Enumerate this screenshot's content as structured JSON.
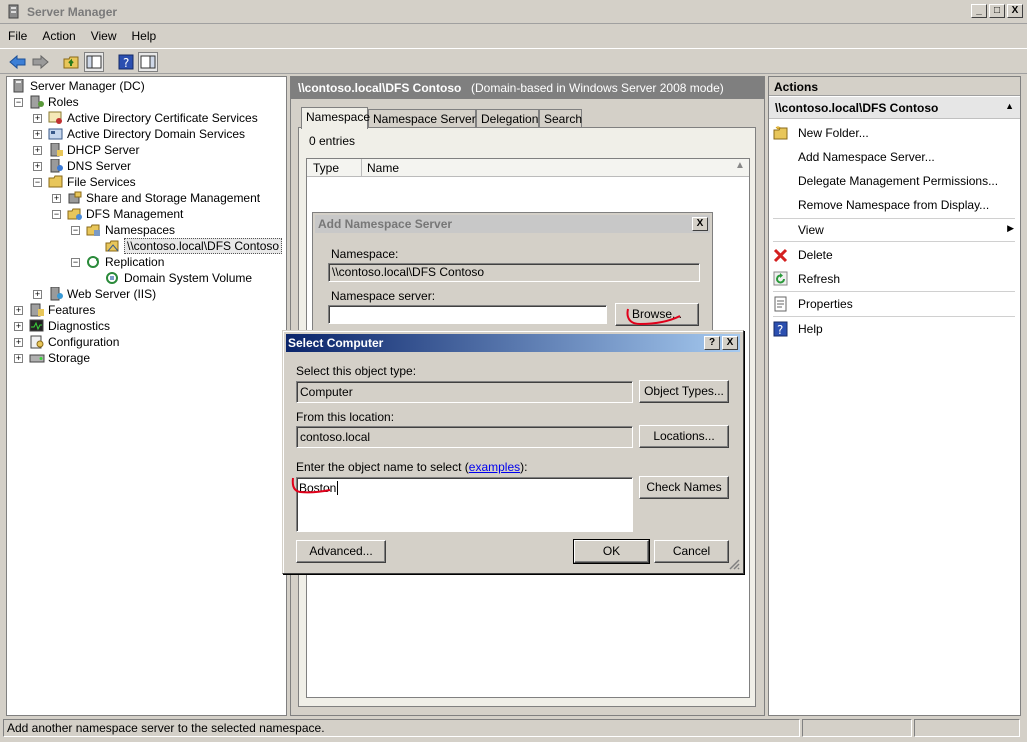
{
  "window": {
    "title": "Server Manager",
    "min": "_",
    "max": "□",
    "close": "X"
  },
  "menu": [
    "File",
    "Action",
    "View",
    "Help"
  ],
  "tree": {
    "root": "Server Manager (DC)",
    "roles": "Roles",
    "ad_cs": "Active Directory Certificate Services",
    "ad_ds": "Active Directory Domain Services",
    "dhcp": "DHCP Server",
    "dns": "DNS Server",
    "file_services": "File Services",
    "share_storage": "Share and Storage Management",
    "dfs_mgmt": "DFS Management",
    "namespaces": "Namespaces",
    "namespace_item": "\\\\contoso.local\\DFS Contoso",
    "replication": "Replication",
    "domain_sys_vol": "Domain System Volume",
    "web_server": "Web Server (IIS)",
    "features": "Features",
    "diagnostics": "Diagnostics",
    "configuration": "Configuration",
    "storage": "Storage"
  },
  "middle": {
    "title": "\\\\contoso.local\\DFS Contoso",
    "subtitle": "(Domain-based in Windows Server 2008 mode)",
    "tabs": [
      "Namespace",
      "Namespace Servers",
      "Delegation",
      "Search"
    ],
    "entries": "0 entries",
    "columns": [
      "Type",
      "Name"
    ]
  },
  "add_ns_dialog": {
    "title": "Add Namespace Server",
    "namespace_label": "Namespace:",
    "namespace_value": "\\\\contoso.local\\DFS Contoso",
    "server_label": "Namespace server:",
    "server_value": "",
    "browse": "Browse..."
  },
  "select_computer": {
    "title": "Select Computer",
    "object_type_label": "Select this object type:",
    "object_type_value": "Computer",
    "object_types_btn": "Object Types...",
    "location_label": "From this location:",
    "location_value": "contoso.local",
    "locations_btn": "Locations...",
    "enter_label_pre": "Enter the object name to select (",
    "enter_label_link": "examples",
    "enter_label_post": "):",
    "object_name_value": "Boston",
    "check_names_btn": "Check Names",
    "advanced_btn": "Advanced...",
    "ok_btn": "OK",
    "cancel_btn": "Cancel",
    "help": "?",
    "close": "X"
  },
  "actions": {
    "header": "Actions",
    "context": "\\\\contoso.local\\DFS Contoso",
    "items": [
      {
        "label": "New Folder...",
        "icon": "new-folder-icon"
      },
      {
        "label": "Add Namespace Server...",
        "icon": ""
      },
      {
        "label": "Delegate Management Permissions...",
        "icon": ""
      },
      {
        "label": "Remove Namespace from Display...",
        "icon": ""
      },
      {
        "label": "View",
        "icon": ""
      },
      {
        "label": "Delete",
        "icon": "delete-icon"
      },
      {
        "label": "Refresh",
        "icon": "refresh-icon"
      },
      {
        "label": "Properties",
        "icon": "properties-icon"
      },
      {
        "label": "Help",
        "icon": "help-icon"
      }
    ]
  },
  "status": {
    "text": "Add another namespace server to the selected namespace."
  },
  "colors": {
    "annotation": "#e0001a",
    "title_gradient_start": "#0a246a",
    "title_gradient_end": "#a6caf0"
  }
}
